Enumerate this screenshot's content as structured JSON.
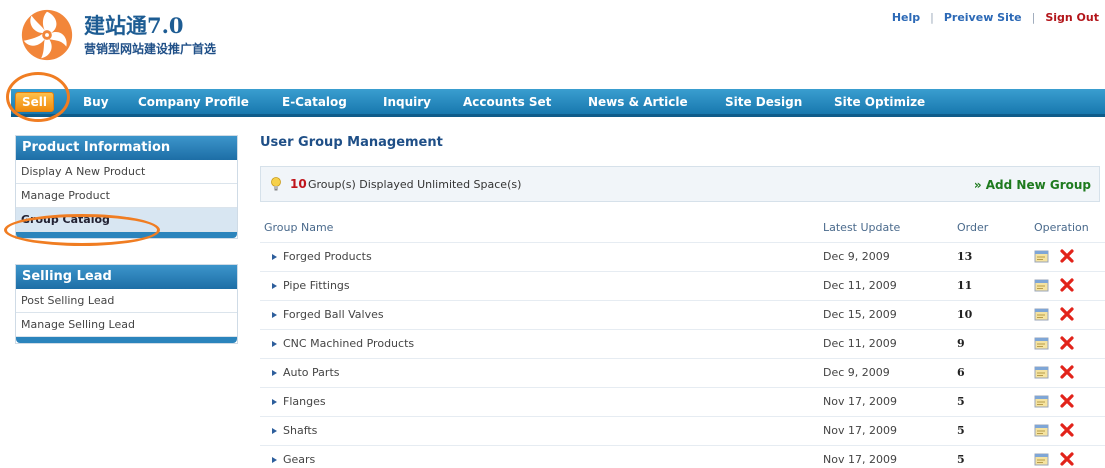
{
  "header": {
    "brand_title": "建站通7.0",
    "brand_subtitle": "营销型网站建设推广首选",
    "links": {
      "help": "Help",
      "preview": "Preivew Site",
      "signout": "Sign Out",
      "separator": "|"
    }
  },
  "nav": {
    "items": [
      "Sell",
      "Buy",
      "Company Profile",
      "E-Catalog",
      "Inquiry",
      "Accounts Set",
      "News & Article",
      "Site Design",
      "Site Optimize"
    ],
    "active": "Sell"
  },
  "sidebar": {
    "sections": [
      {
        "title": "Product Information",
        "items": [
          "Display A New Product",
          "Manage Product",
          "Group Catalog"
        ],
        "selected": "Group Catalog"
      },
      {
        "title": "Selling Lead",
        "items": [
          "Post Selling Lead",
          "Manage Selling Lead"
        ]
      }
    ]
  },
  "main": {
    "title": "User Group Management",
    "info": {
      "count": "10",
      "text": "Group(s) Displayed Unlimited Space(s)",
      "add_link": "» Add New Group"
    },
    "columns": [
      "Group Name",
      "Latest Update",
      "Order",
      "Operation"
    ],
    "rows": [
      {
        "name": "Forged Products",
        "date": "Dec 9, 2009",
        "order": "13"
      },
      {
        "name": "Pipe Fittings",
        "date": "Dec 11, 2009",
        "order": "11"
      },
      {
        "name": "Forged Ball Valves",
        "date": "Dec 15, 2009",
        "order": "10"
      },
      {
        "name": "CNC Machined Products",
        "date": "Dec 11, 2009",
        "order": "9"
      },
      {
        "name": "Auto Parts",
        "date": "Dec 9, 2009",
        "order": "6"
      },
      {
        "name": "Flanges",
        "date": "Nov 17, 2009",
        "order": "5"
      },
      {
        "name": "Shafts",
        "date": "Nov 17, 2009",
        "order": "5"
      },
      {
        "name": "Gears",
        "date": "Nov 17, 2009",
        "order": "5"
      }
    ]
  },
  "colors": {
    "nav_blue": "#1878ae",
    "active_orange": "#f08a0c",
    "highlight_ring": "#f07d22",
    "count_red": "#c0141b",
    "add_green": "#1e7a1e"
  },
  "icons": {
    "logo": "flower-logo-icon",
    "info": "bulb-icon",
    "edit": "edit-icon",
    "delete": "delete-icon"
  }
}
